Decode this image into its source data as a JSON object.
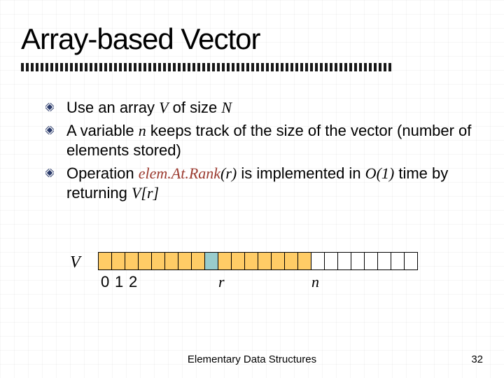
{
  "title": "Array-based Vector",
  "bullets": {
    "b1_pre": "Use an array ",
    "b1_V": "V",
    "b1_mid": " of size ",
    "b1_N": "N",
    "b2_pre": "A variable ",
    "b2_n": "n",
    "b2_post": " keeps track of the size of the vector (number of elements stored)",
    "b3_pre": "Operation ",
    "b3_call": "elem.At.Rank",
    "b3_paren_open": "(",
    "b3_r": "r",
    "b3_paren_close": ")",
    "b3_mid": " is implemented in ",
    "b3_O": "O",
    "b3_O_args": "(1)",
    "b3_mid2": " time by returning ",
    "b3_V": "V",
    "b3_idx_open": "[",
    "b3_ridx": "r",
    "b3_idx_close": "]"
  },
  "diagram": {
    "array_label": "V",
    "indices": {
      "i0": "0",
      "i1": "1",
      "i2": "2",
      "r": "r",
      "n": "n"
    },
    "cells_total": 24,
    "highlight_index": 8,
    "n_index": 15
  },
  "footer": "Elementary Data Structures",
  "page_number": "32"
}
